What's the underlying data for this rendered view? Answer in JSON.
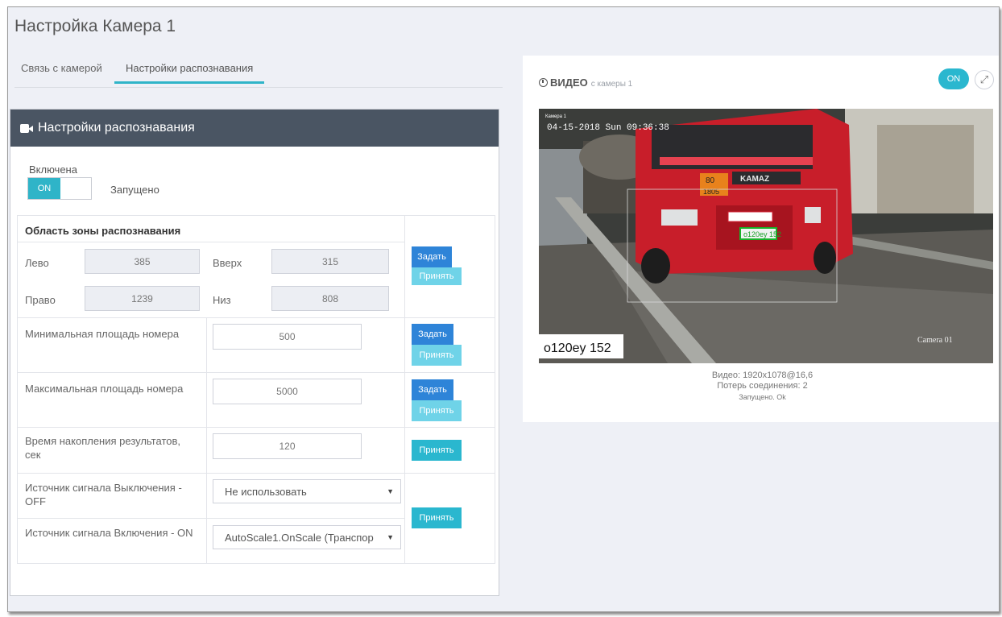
{
  "page": {
    "title": "Настройка Камера 1"
  },
  "tabs": [
    {
      "label": "Связь с камерой",
      "active": false
    },
    {
      "label": "Настройки распознавания",
      "active": true
    }
  ],
  "settings": {
    "header": "Настройки распознавания",
    "enabled_label": "Включена",
    "toggle_on": "ON",
    "status": "Запущено",
    "zone": {
      "title": "Область зоны распознавания",
      "left_label": "Лево",
      "left_value": "385",
      "top_label": "Вверх",
      "top_value": "315",
      "right_label": "Право",
      "right_value": "1239",
      "bottom_label": "Низ",
      "bottom_value": "808"
    },
    "min_area": {
      "label": "Минимальная площадь номера",
      "value": "500"
    },
    "max_area": {
      "label": "Максимальная площадь номера",
      "value": "5000"
    },
    "accum_time": {
      "label": "Время накопления результатов, сек",
      "value": "120"
    },
    "off_source": {
      "label": "Источник сигнала Выключения - OFF",
      "value": "Не использовать"
    },
    "on_source": {
      "label": "Источник сигнала Включения - ON",
      "value": "AutoScale1.OnScale (Транспор"
    },
    "buttons": {
      "set": "Задать",
      "apply": "Принять"
    }
  },
  "video": {
    "title": "ВИДЕО",
    "subtitle": "с камеры 1",
    "on_label": "ON",
    "overlay_timestamp": "04-15-2018 Sun 09:36:38",
    "overlay_camera_name": "Камера 1",
    "overlay_camera_label": "Camera 01",
    "plate_text": "o120ey 152",
    "plate_detect": "o120ey 152",
    "truck_brand": "KAMAZ",
    "hazard_top": "80",
    "hazard_bottom": "1805",
    "info_line1": "Видео: 1920x1078@16,6",
    "info_line2": "Потерь соединения: 2",
    "info_line3": "Запущено. Ok"
  },
  "colors": {
    "accent": "#2fb4c8",
    "header_bg": "#4a5563",
    "btn_set": "#2e84d8",
    "btn_apply": "#6fd3e8"
  }
}
